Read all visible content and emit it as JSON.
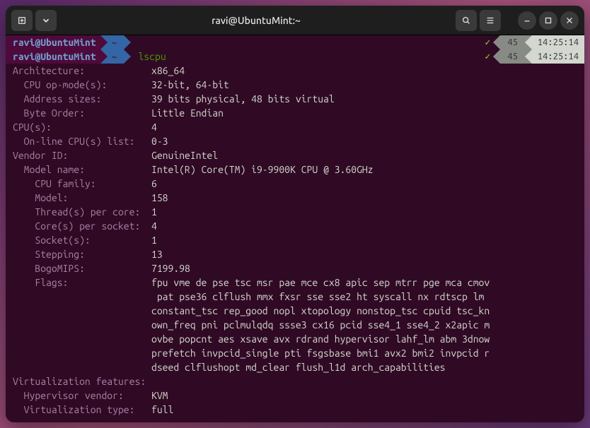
{
  "title": "ravi@UbuntuMint:~",
  "prompt": {
    "user": " ravi@UbuntuMint ",
    "dir": "~",
    "cmd": "lscpu"
  },
  "status": {
    "check": "✓",
    "num": "45",
    "time": "14:25:14"
  },
  "rows": [
    {
      "i": 0,
      "l": "Architecture:",
      "v": "x86_64"
    },
    {
      "i": 1,
      "l": "CPU op-mode(s):",
      "v": "32-bit, 64-bit"
    },
    {
      "i": 1,
      "l": "Address sizes:",
      "v": "39 bits physical, 48 bits virtual"
    },
    {
      "i": 1,
      "l": "Byte Order:",
      "v": "Little Endian"
    },
    {
      "i": 0,
      "l": "CPU(s):",
      "v": "4"
    },
    {
      "i": 1,
      "l": "On-line CPU(s) list:",
      "v": "0-3"
    },
    {
      "i": 0,
      "l": "Vendor ID:",
      "v": "GenuineIntel"
    },
    {
      "i": 1,
      "l": "Model name:",
      "v": "Intel(R) Core(TM) i9-9900K CPU @ 3.60GHz"
    },
    {
      "i": 2,
      "l": "CPU family:",
      "v": "6"
    },
    {
      "i": 2,
      "l": "Model:",
      "v": "158"
    },
    {
      "i": 2,
      "l": "Thread(s) per core:",
      "v": "1"
    },
    {
      "i": 2,
      "l": "Core(s) per socket:",
      "v": "4"
    },
    {
      "i": 2,
      "l": "Socket(s):",
      "v": "1"
    },
    {
      "i": 2,
      "l": "Stepping:",
      "v": "13"
    },
    {
      "i": 2,
      "l": "BogoMIPS:",
      "v": "7199.98"
    }
  ],
  "flags_label": "Flags:",
  "flags_lines": [
    "fpu vme de pse tsc msr pae mce cx8 apic sep mtrr pge mca cmov",
    " pat pse36 clflush mmx fxsr sse sse2 ht syscall nx rdtscp lm ",
    "constant_tsc rep_good nopl xtopology nonstop_tsc cpuid tsc_kn",
    "own_freq pni pclmulqdq ssse3 cx16 pcid sse4_1 sse4_2 x2apic m",
    "ovbe popcnt aes xsave avx rdrand hypervisor lahf_lm abm 3dnow",
    "prefetch invpcid_single pti fsgsbase bmi1 avx2 bmi2 invpcid r",
    "dseed clflushopt md_clear flush_l1d arch_capabilities"
  ],
  "virt_header": "Virtualization features:",
  "virt_rows": [
    {
      "i": 1,
      "l": "Hypervisor vendor:",
      "v": "KVM"
    },
    {
      "i": 1,
      "l": "Virtualization type:",
      "v": "full"
    }
  ]
}
